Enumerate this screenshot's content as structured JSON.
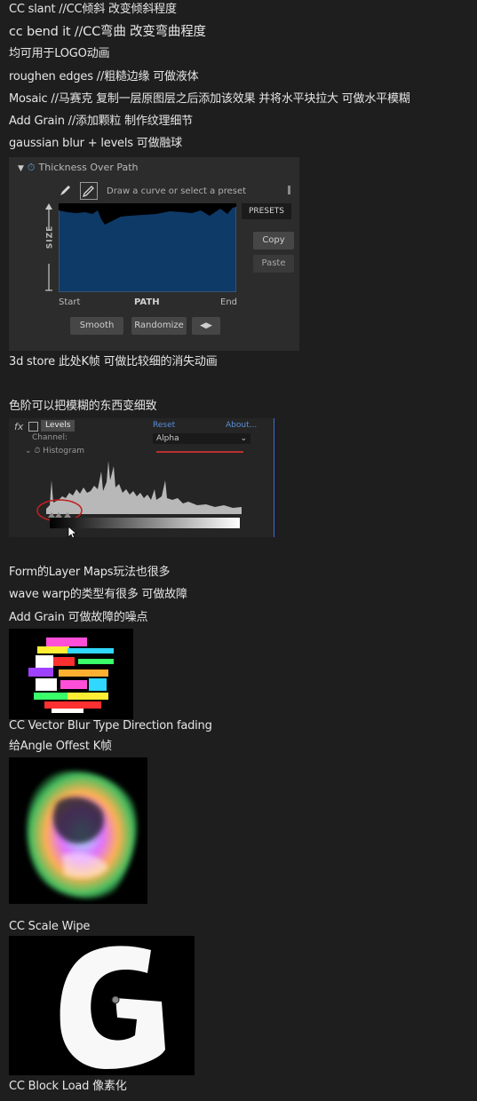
{
  "lines": [
    "CC slant //CC倾斜 改变倾斜程度",
    "cc bend it //CC弯曲 改变弯曲程度",
    "均可用于LOGO动画",
    "roughen edges //粗糙边缘 可做液体",
    "Mosaic //马赛克 复制一层原图层之后添加该效果 并将水平块拉大 可做水平模糊",
    "Add Grain //添加颗粒 制作纹理细节",
    "gaussian blur + levels 可做融球",
    "3d store 此处K帧 可做比较细的消失动画",
    "色阶可以把模糊的东西变细致",
    "Form的Layer Maps玩法也很多",
    "wave warp的类型有很多 可做故障",
    "Add Grain 可做故障的噪点",
    "CC Vector Blur  Type Direction fading",
    "给Angle Offest K帧",
    "CC Scale Wipe",
    "CC Block Load 像素化"
  ],
  "thickness_panel": {
    "title": "Thickness Over Path",
    "hint": "Draw a curve or select a preset",
    "presets": "PRESETS",
    "copy": "Copy",
    "paste": "Paste",
    "axis": "SIZE",
    "start": "Start",
    "path": "PATH",
    "end": "End",
    "smooth": "Smooth",
    "randomize": "Randomize"
  },
  "levels_panel": {
    "fx": "fx",
    "name": "Levels",
    "reset": "Reset",
    "about": "About...",
    "channel_label": "Channel:",
    "channel_value": "Alpha",
    "histogram": "Histogram"
  },
  "colors": {
    "background": "#1e1e1e",
    "text": "#e6e6e6",
    "graph_fill": "#0e3a68",
    "accent_blue": "#5a8fd8",
    "red_mark": "#c02020"
  }
}
